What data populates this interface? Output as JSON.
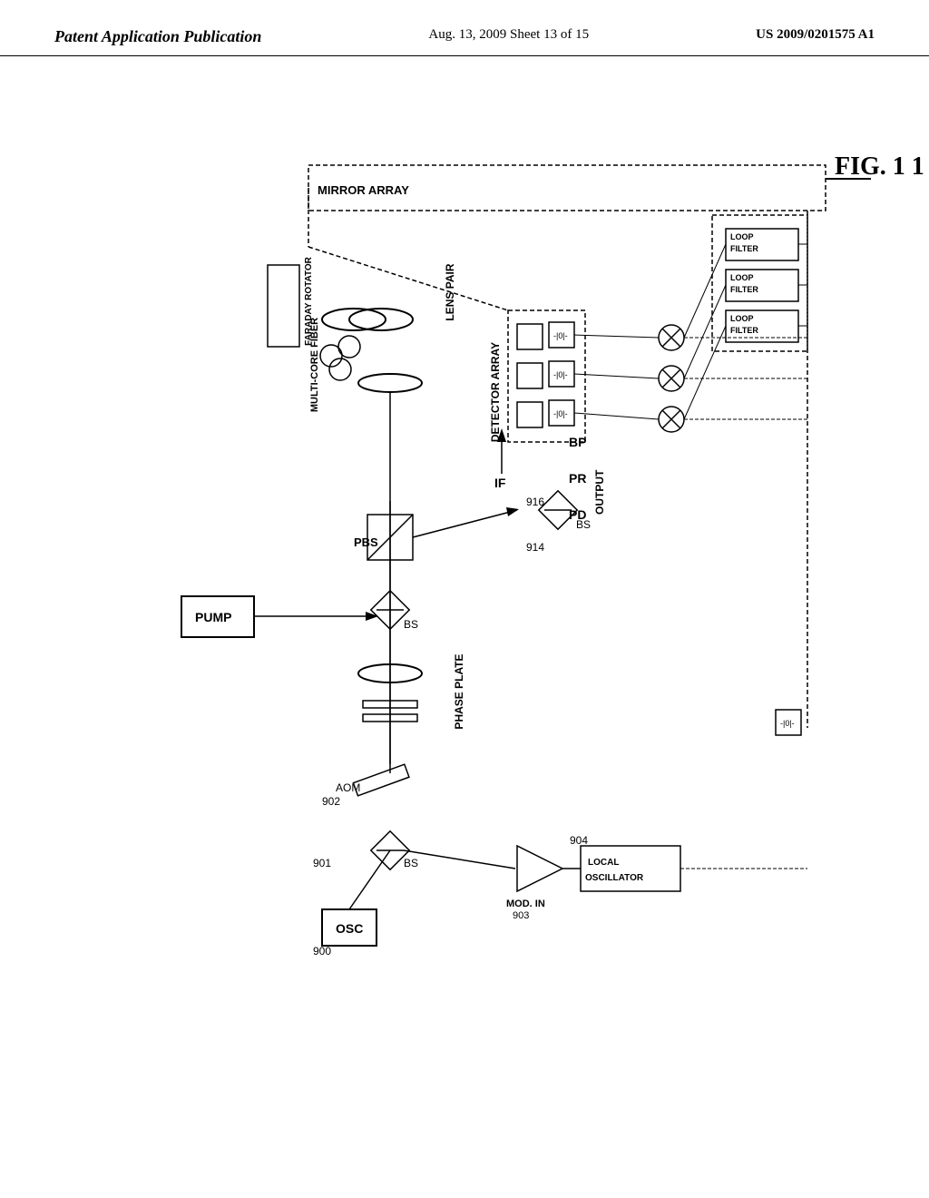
{
  "header": {
    "left": "Patent Application Publication",
    "center": "Aug. 13, 2009  Sheet 13 of 15",
    "right": "US 2009/0201575 A1"
  },
  "figure": {
    "title": "FIG. 11",
    "labels": {
      "mirror_array": "MIRROR ARRAY",
      "faraday_rotator": "FARADAY ROTATOR",
      "lens_pair": "LENS PAIR",
      "multi_core_fiber": "MULTI-CORE FIBER",
      "detector_array": "DETECTOR ARRAY",
      "loop_filter1": "LOOP FILTER",
      "loop_filter2": "LOOP FILTER",
      "loop_filter3": "LOOP FILTER",
      "pbs": "PBS",
      "bs1": "BS",
      "bs2": "BS",
      "bs3": "BS",
      "if": "IF",
      "bp": "BP",
      "pr": "PR",
      "pd": "PD",
      "output": "OUTPUT",
      "phase_plate": "PHASE PLATE",
      "pump": "PUMP",
      "aom": "AOM",
      "mod_in": "MOD. IN",
      "local_oscillator": "LOCAL OSCILLATOR",
      "osc": "OSC",
      "n900": "900",
      "n901": "901",
      "n902": "902",
      "n903": "903",
      "n904": "904",
      "n914": "914",
      "n916": "916"
    }
  }
}
